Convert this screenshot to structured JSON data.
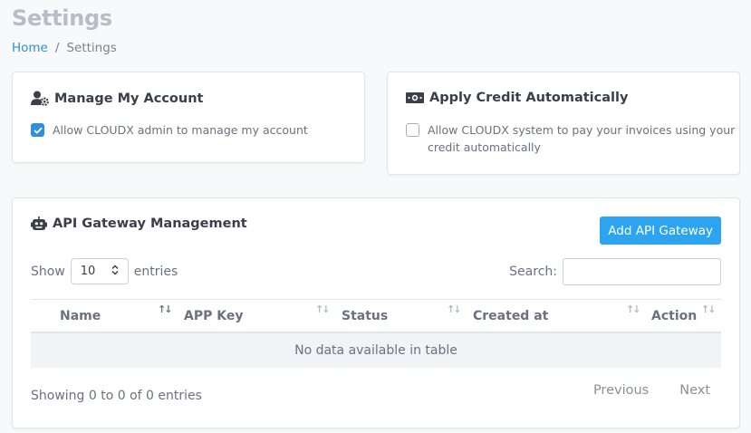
{
  "page": {
    "title": "Settings",
    "breadcrumb": {
      "home": "Home",
      "separator": "/",
      "current": "Settings"
    }
  },
  "manage_account": {
    "title": "Manage My Account",
    "icon": "user-gear-icon",
    "checkbox_label": "Allow CLOUDX admin to manage my account",
    "checked": true
  },
  "apply_credit": {
    "title": "Apply Credit Automatically",
    "icon": "money-bill-icon",
    "checkbox_label_line1": "Allow CLOUDX system to pay your invoices using your",
    "checkbox_label_line2": "credit automatically",
    "checked": false
  },
  "api_gateway": {
    "title": "API Gateway Management",
    "icon": "robot-icon",
    "add_button": "Add API Gateway",
    "show_label": "Show",
    "entries_select": "10",
    "entries_label": "entries",
    "search_label": "Search:",
    "search_value": "",
    "columns": [
      "Name",
      "APP Key",
      "Status",
      "Created at",
      "Action"
    ],
    "sort_glyph": "↑↓",
    "empty_message": "No data available in table",
    "info": "Showing 0 to 0 of 0 entries",
    "pager": {
      "previous": "Previous",
      "next": "Next"
    }
  },
  "colors": {
    "accent": "#2d8fde",
    "button": "#2da4f0",
    "title_gray": "#b8bcc6",
    "background": "#f8f9fa"
  }
}
